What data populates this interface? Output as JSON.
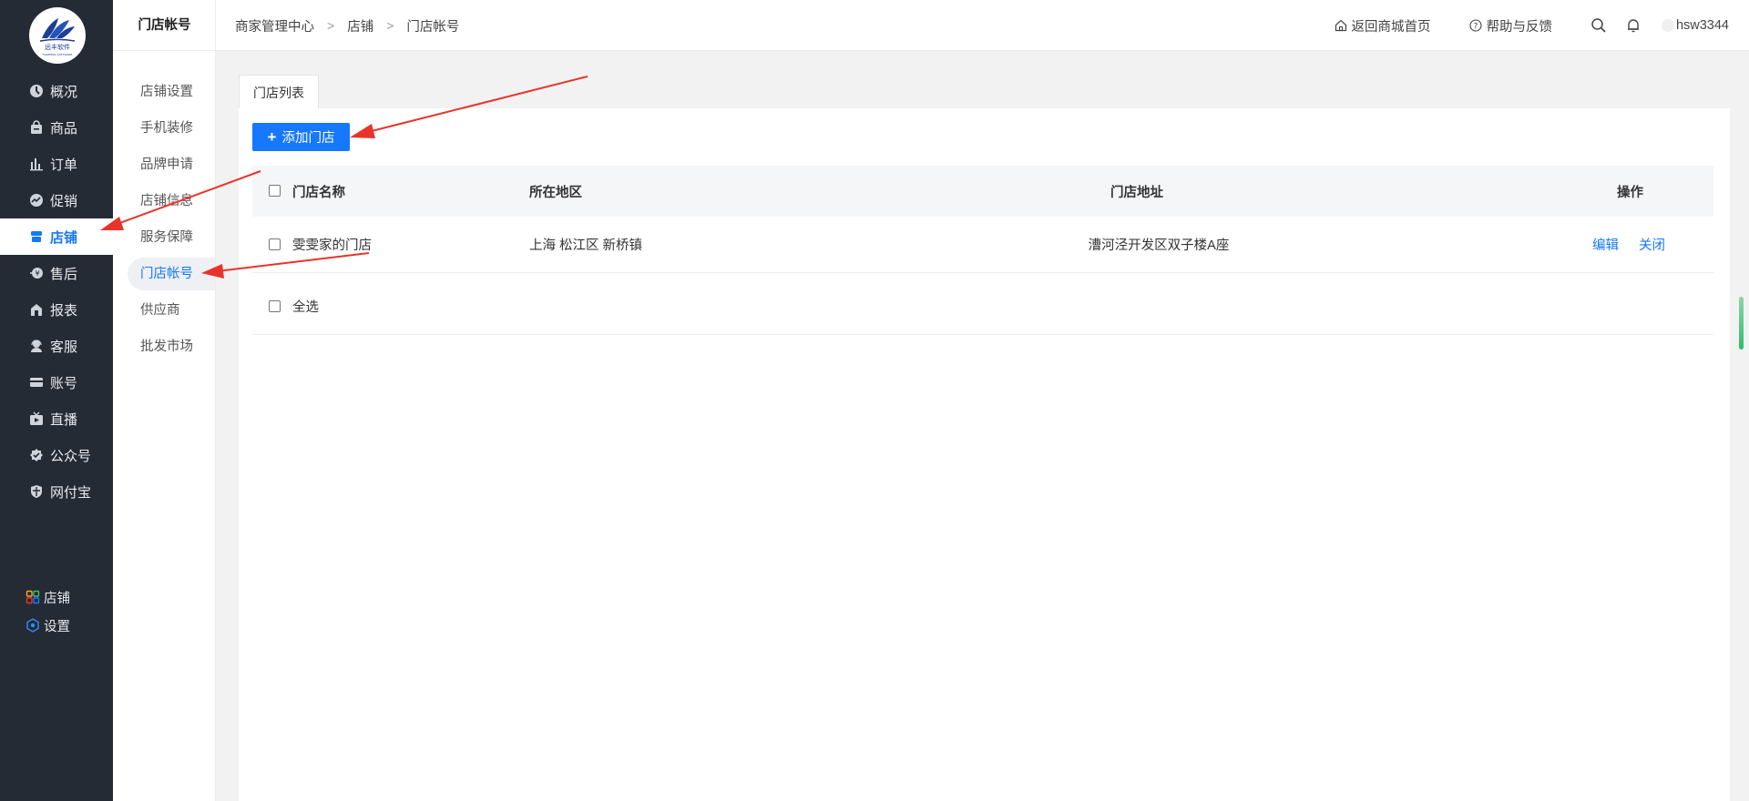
{
  "sidebar": {
    "logo_text": "远丰软件",
    "items": [
      {
        "label": "概况",
        "icon": "dashboard-icon"
      },
      {
        "label": "商品",
        "icon": "bag-icon"
      },
      {
        "label": "订单",
        "icon": "bar-chart-icon"
      },
      {
        "label": "促销",
        "icon": "promotion-icon"
      },
      {
        "label": "店铺",
        "icon": "store-icon"
      },
      {
        "label": "售后",
        "icon": "after-sale-icon"
      },
      {
        "label": "报表",
        "icon": "report-icon"
      },
      {
        "label": "客服",
        "icon": "customer-service-icon"
      },
      {
        "label": "账号",
        "icon": "card-icon"
      },
      {
        "label": "直播",
        "icon": "live-icon"
      },
      {
        "label": "公众号",
        "icon": "badge-check-icon"
      },
      {
        "label": "网付宝",
        "icon": "shield-icon"
      }
    ],
    "active_index": 4,
    "bottom": [
      {
        "label": "店铺",
        "icon": "grid-icon"
      },
      {
        "label": "设置",
        "icon": "settings-icon"
      }
    ]
  },
  "submenu": {
    "title": "门店帐号",
    "items": [
      "店铺设置",
      "手机装修",
      "品牌申请",
      "店铺信息",
      "服务保障",
      "门店帐号",
      "供应商",
      "批发市场"
    ],
    "active_index": 5
  },
  "header": {
    "breadcrumb": [
      "商家管理中心",
      "店铺",
      "门店帐号"
    ],
    "home_link": "返回商城首页",
    "help_link": "帮助与反馈",
    "username": "hsw3344"
  },
  "content": {
    "tab_label": "门店列表",
    "add_button": "添加门店",
    "columns": [
      "门店名称",
      "所在地区",
      "门店地址",
      "操作"
    ],
    "rows": [
      {
        "name": "雯雯家的门店",
        "region": "上海 松江区 新桥镇",
        "address": "漕河泾开发区双子楼A座",
        "edit": "编辑",
        "close": "关闭"
      }
    ],
    "select_all": "全选"
  },
  "colors": {
    "sidebar_bg": "#252b35",
    "accent": "#1677ff",
    "annotation_arrow": "#e8332a"
  }
}
